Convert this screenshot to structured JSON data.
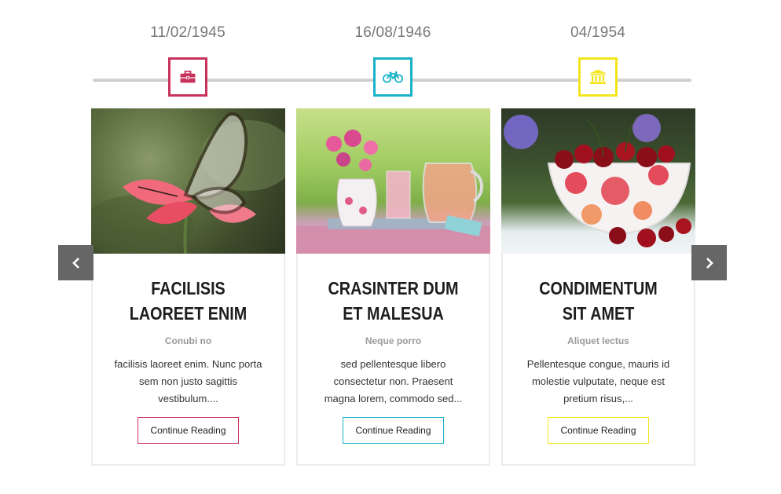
{
  "timeline": [
    {
      "date": "11/02/1945",
      "icon": "briefcase-icon",
      "color": "#c8325a"
    },
    {
      "date": "16/08/1946",
      "icon": "bicycle-icon",
      "color": "#19b3c9"
    },
    {
      "date": "04/1954",
      "icon": "bank-icon",
      "color": "#f2e51b"
    }
  ],
  "cards": [
    {
      "title": "FACILISIS LAOREET ENIM",
      "subtitle": "Conubi no",
      "text": "facilisis laoreet enim. Nunc porta sem non justo sagittis vestibulum....",
      "button": "Continue Reading",
      "color": "#c8325a",
      "image": "butterfly on pink flower"
    },
    {
      "title": "CRASINTER DUM ET MALESUA",
      "subtitle": "Neque porro",
      "text": "sed pellentesque libero consectetur non. Praesent magna lorem, commodo sed...",
      "button": "Continue Reading",
      "color": "#19b3c9",
      "image": "pink lemonade and flowers"
    },
    {
      "title": "CONDIMENTUM SIT AMET",
      "subtitle": "Aliquet lectus",
      "text": "Pellentesque congue, mauris id molestie vulputate, neque est pretium risus,...",
      "button": "Continue Reading",
      "color": "#f2e51b",
      "image": "bowl of cherries"
    }
  ],
  "nav": {
    "prev_icon": "chevron-left-icon",
    "next_icon": "chevron-right-icon"
  }
}
